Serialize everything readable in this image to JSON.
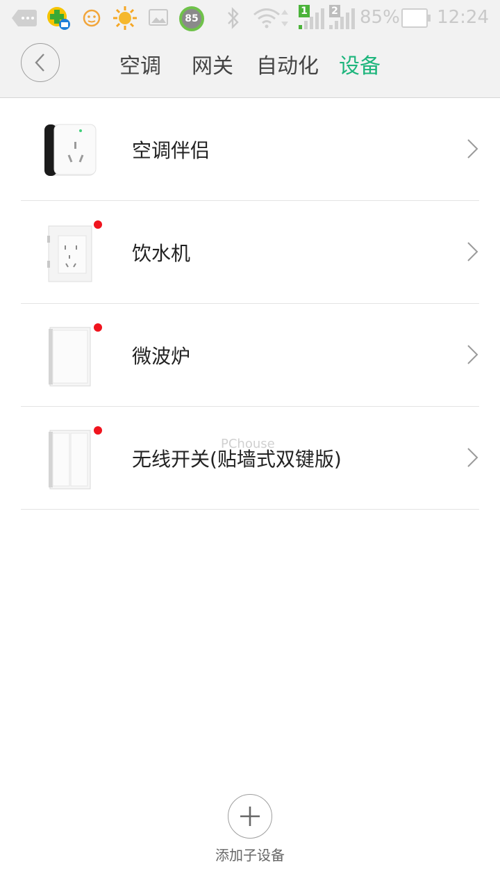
{
  "status_bar": {
    "notification_badge": "85",
    "sim1": "1",
    "sim2": "2",
    "battery_percent": "85%",
    "time": "12:24",
    "icons": [
      "message-icon",
      "app-notify-icon",
      "face-icon",
      "weather-sun-icon",
      "image-icon",
      "badge-85-icon",
      "bluetooth-icon",
      "wifi-icon",
      "signal-sim1-icon",
      "signal-sim2-icon",
      "battery-icon"
    ]
  },
  "header": {
    "back_icon": "chevron-left-icon",
    "tabs": [
      {
        "label": "空调",
        "active": false
      },
      {
        "label": "网关",
        "active": false
      },
      {
        "label": "自动化",
        "active": false
      },
      {
        "label": "设备",
        "active": true
      }
    ]
  },
  "devices": [
    {
      "name": "空调伴侣",
      "new": false,
      "thumb": "ac-companion-plug"
    },
    {
      "name": "饮水机",
      "new": true,
      "thumb": "wall-socket"
    },
    {
      "name": "微波炉",
      "new": true,
      "thumb": "wall-switch-single"
    },
    {
      "name": "无线开关(贴墙式双键版)",
      "new": true,
      "thumb": "wall-switch-double"
    }
  ],
  "watermark": "PChouse",
  "add_device": {
    "label": "添加子设备",
    "icon": "plus-icon"
  },
  "colors": {
    "accent": "#1db57c",
    "new_dot": "#f0141e",
    "header_bg": "#f2f2f2"
  }
}
